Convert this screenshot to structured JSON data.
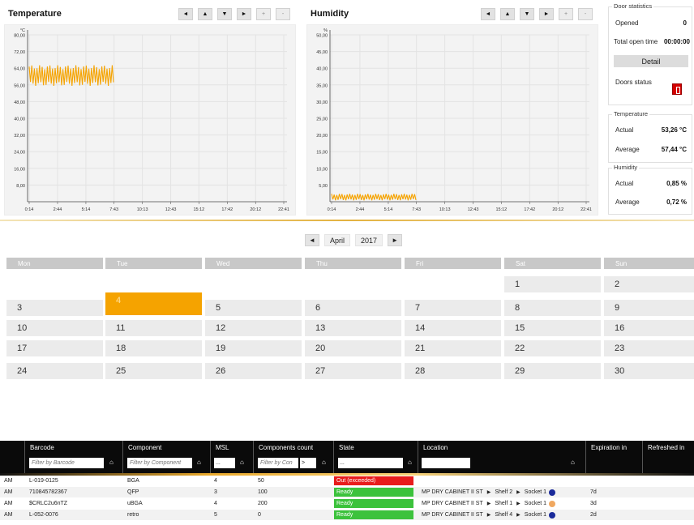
{
  "temperature_chart": {
    "title": "Temperature",
    "unit": "°C",
    "toolbar": [
      "◄",
      "▲",
      "▼",
      "►",
      "+",
      "-"
    ],
    "chart_data": {
      "type": "line",
      "title": "Temperature",
      "ylabel": "°C",
      "ylim": [
        0,
        80
      ],
      "yticks": [
        "80,00",
        "72,00",
        "64,00",
        "56,00",
        "48,00",
        "40,00",
        "32,00",
        "24,00",
        "16,00",
        "8,00"
      ],
      "xticks": [
        "0:14",
        "2:44",
        "5:14",
        "7:43",
        "10:13",
        "12:43",
        "15:12",
        "17:42",
        "20:12",
        "22:41"
      ],
      "grid": true,
      "series": [
        {
          "color": "#f5a300",
          "band_min": 56.5,
          "band_max": 64.5,
          "x_start": "0:14",
          "x_end": "7:43"
        }
      ]
    }
  },
  "humidity_chart": {
    "title": "Humidity",
    "unit": "%",
    "toolbar": [
      "◄",
      "▲",
      "▼",
      "►",
      "+",
      "-"
    ],
    "chart_data": {
      "type": "line",
      "title": "Humidity",
      "ylabel": "%",
      "ylim": [
        0,
        50
      ],
      "yticks": [
        "50,00",
        "45,00",
        "40,00",
        "35,00",
        "30,00",
        "25,00",
        "20,00",
        "15,00",
        "10,00",
        "5,00"
      ],
      "xticks": [
        "0:14",
        "2:44",
        "5:14",
        "7:43",
        "10:13",
        "12:43",
        "15:12",
        "17:42",
        "20:12",
        "22:41"
      ],
      "grid": true,
      "series": [
        {
          "color": "#f5a300",
          "band_min": 0.6,
          "band_max": 2.2,
          "x_start": "0:14",
          "x_end": "7:43"
        }
      ]
    }
  },
  "door_statistics": {
    "legend": "Door statistics",
    "opened_label": "Opened",
    "opened_value": "0",
    "total_open_time_label": "Total open time",
    "total_open_time_value": "00:00:00",
    "detail_button": "Detail",
    "doors_status_label": "Doors status",
    "door_icon_text": "1"
  },
  "temperature_stats": {
    "legend": "Temperature",
    "actual_label": "Actual",
    "actual_value": "53,26 °C",
    "average_label": "Average",
    "average_value": "57,44 °C"
  },
  "humidity_stats": {
    "legend": "Humidity",
    "actual_label": "Actual",
    "actual_value": "0,85 %",
    "average_label": "Average",
    "average_value": "0,72 %"
  },
  "calendar": {
    "prev": "◄",
    "next": "►",
    "month": "April",
    "year": "2017",
    "weekdays": [
      "Mon",
      "Tue",
      "Wed",
      "Thu",
      "Fri",
      "Sat",
      "Sun"
    ],
    "weeks": [
      [
        "",
        "",
        "",
        "",
        "",
        "1",
        "2"
      ],
      [
        "3",
        "4",
        "5",
        "6",
        "7",
        "8",
        "9"
      ],
      [
        "10",
        "11",
        "12",
        "13",
        "14",
        "15",
        "16"
      ],
      [
        "17",
        "18",
        "19",
        "20",
        "21",
        "22",
        "23"
      ],
      [
        "24",
        "25",
        "26",
        "27",
        "28",
        "29",
        "30"
      ]
    ],
    "selected": "4"
  },
  "grid": {
    "columns": {
      "barcode": "Barcode",
      "component": "Component",
      "msl": "MSL",
      "components_count": "Components count",
      "state": "State",
      "location": "Location",
      "expiration_in": "Expiration in",
      "refreshed_in": "Refreshed in"
    },
    "filters": {
      "barcode_placeholder": "Filter by Barcode",
      "component_placeholder": "Filter by Component",
      "msl_value": "...",
      "count_placeholder": "Filter by Con",
      "count_op": ">",
      "state_value": "..."
    },
    "rows": [
      {
        "time": "AM",
        "barcode": "L-019-0125",
        "component": "BGA",
        "msl": "4",
        "count": "50",
        "state": "Out (exceeded)",
        "state_color": "#e81c1c",
        "location": [],
        "dot_color": "",
        "expiration": ""
      },
      {
        "time": "AM",
        "barcode": "710845782367",
        "component": "QFP",
        "msl": "3",
        "count": "100",
        "state": "Ready",
        "state_color": "#3cc23c",
        "location": [
          "MP DRY CABINET II ST",
          "Shelf 2",
          "Socket 1"
        ],
        "dot_color": "#1a2a9a",
        "expiration": "7d"
      },
      {
        "time": "AM",
        "barcode": "$CRLC2u6nTZ",
        "component": "uBGA",
        "msl": "4",
        "count": "200",
        "state": "Ready",
        "state_color": "#3cc23c",
        "location": [
          "MP DRY CABINET II ST",
          "Shelf 1",
          "Socket 1"
        ],
        "dot_color": "#f0a860",
        "expiration": "3d"
      },
      {
        "time": "AM",
        "barcode": "L-052-0076",
        "component": "retro",
        "msl": "5",
        "count": "0",
        "state": "Ready",
        "state_color": "#3cc23c",
        "location": [
          "MP DRY CABINET II ST",
          "Shelf 4",
          "Socket 1"
        ],
        "dot_color": "#1a2a9a",
        "expiration": "2d"
      }
    ]
  }
}
